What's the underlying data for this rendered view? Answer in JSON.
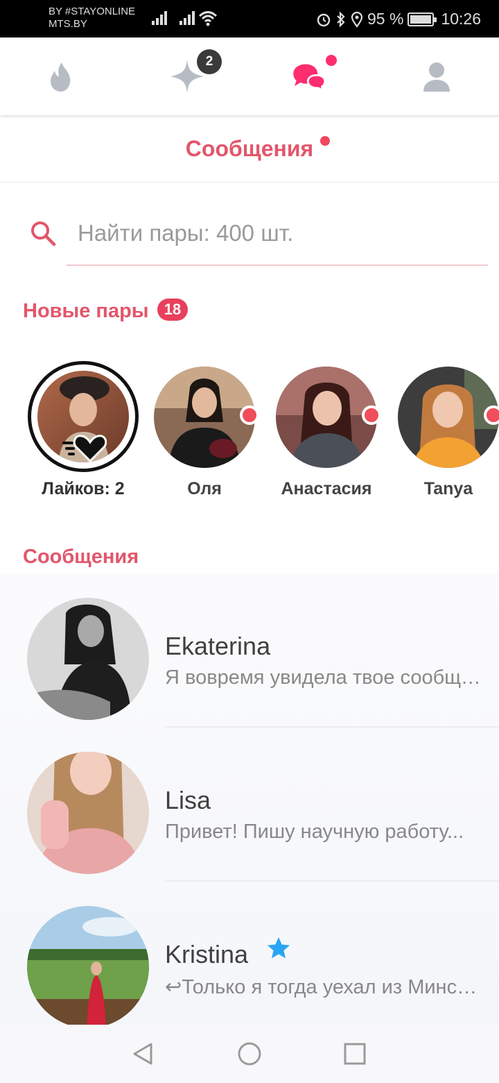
{
  "status_bar": {
    "carrier_line1": "BY #STAYONLINE",
    "carrier_line2": "MTS.BY",
    "battery": "95 %",
    "time": "10:26"
  },
  "top_nav": {
    "items": [
      {
        "name": "flame-icon"
      },
      {
        "name": "sparkle-icon",
        "badge": "2"
      },
      {
        "name": "chat-icon"
      },
      {
        "name": "profile-icon"
      }
    ]
  },
  "header": {
    "title": "Сообщения"
  },
  "search": {
    "placeholder": "Найти пары: 400 шт."
  },
  "new_matches": {
    "heading": "Новые пары",
    "count": "18",
    "likes_label": "Лайков: 2",
    "items": [
      {
        "name": "Оля"
      },
      {
        "name": "Анастасия"
      },
      {
        "name": "Tanya"
      }
    ]
  },
  "messages": {
    "heading": "Сообщения",
    "items": [
      {
        "name": "Ekaterina",
        "preview": "Я вовремя увидела твое сообщение..."
      },
      {
        "name": "Lisa",
        "preview": "Привет! Пишу научную работу..."
      },
      {
        "name": "Kristina",
        "preview": "↩Только я тогда уехал из Минска..."
      }
    ]
  },
  "colors": {
    "accent": "#e2566b",
    "badge_red": "#e8405d",
    "online_dot": "#ef4e5a",
    "chat_icon": "#fe2d6e",
    "star_blue": "#2aa5f5"
  }
}
